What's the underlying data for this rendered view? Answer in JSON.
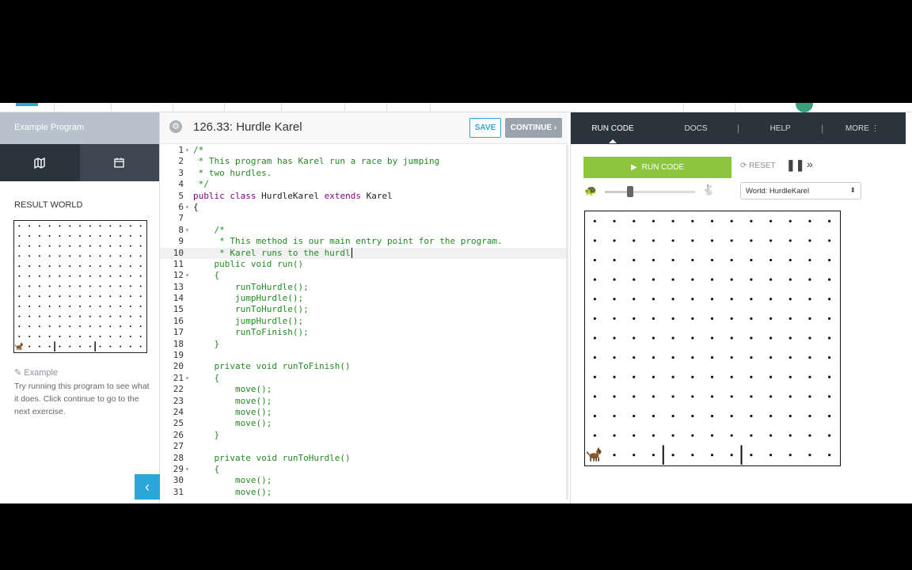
{
  "left": {
    "header": "Example Program",
    "tabs": [
      {
        "icon": "map-icon",
        "active": true
      },
      {
        "icon": "calendar-icon",
        "active": false
      }
    ],
    "result_world_label": "RESULT WORLD",
    "example_title": "Example",
    "example_desc": "Try running this program to see what it does. Click continue to go to the next exercise."
  },
  "editor": {
    "title": "126.33: Hurdle Karel",
    "save_label": "SAVE",
    "continue_label": "CONTINUE ›",
    "current_line": 10,
    "lines": [
      "/*",
      " * This program has Karel run a race by jumping",
      " * two hurdles.",
      " */",
      "public class HurdleKarel extends Karel",
      "{",
      "",
      "    /*",
      "     * This method is our main entry point for the program.",
      "     * Karel runs to the hurdl",
      "    public void run()",
      "    {",
      "        runToHurdle();",
      "        jumpHurdle();",
      "        runToHurdle();",
      "        jumpHurdle();",
      "        runToFinish();",
      "    }",
      "",
      "    private void runToFinish()",
      "    {",
      "        move();",
      "        move();",
      "        move();",
      "        move();",
      "    }",
      "",
      "    private void runToHurdle()",
      "    {",
      "        move();",
      "        move();",
      "        move();"
    ],
    "fold_lines": [
      1,
      6,
      8,
      12,
      21,
      29
    ]
  },
  "right": {
    "nav": [
      "RUN CODE",
      "DOCS",
      "HELP",
      "MORE ⋮"
    ],
    "run_label": "RUN CODE",
    "reset_label": "RESET",
    "world_select": "World: HurdleKarel",
    "speed": 0.28
  },
  "world": {
    "cols": 13,
    "rows": 13,
    "karel_col": 0,
    "karel_row_from_bottom": 0,
    "walls_after_col": [
      3,
      7
    ]
  },
  "colors": {
    "accent": "#2aa6d8",
    "run_green": "#8cc63f",
    "nav_dark": "#2b333c"
  }
}
